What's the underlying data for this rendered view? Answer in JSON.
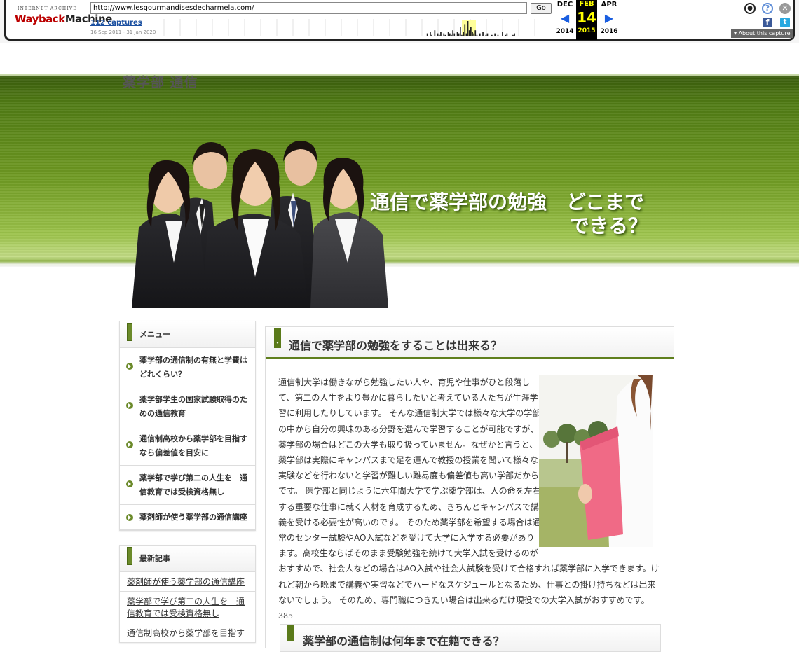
{
  "wayback": {
    "logo_top": "INTERNET ARCHIVE",
    "logo_main_a": "Wayback",
    "logo_main_b": "Machine",
    "url": "http://www.lesgourmandisesdecharmela.com/",
    "go_label": "Go",
    "captures": "112 captures",
    "range": "16 Sep 2011 - 31 Jan 2020",
    "prev_month": "DEC",
    "prev_year": "2014",
    "cur_month": "FEB",
    "cur_day": "14",
    "cur_year": "2015",
    "next_month": "APR",
    "next_year": "2016",
    "about": "About this capture",
    "sparkline": [
      0,
      0,
      0,
      0,
      0,
      0,
      0,
      0,
      0,
      0,
      0,
      0,
      0,
      0,
      0,
      0,
      0,
      0,
      0,
      0,
      0,
      0,
      0,
      0,
      0,
      0,
      0,
      0,
      0,
      0,
      0,
      0,
      0,
      0,
      0,
      0,
      0,
      0,
      0,
      0,
      0,
      0,
      0,
      0,
      0,
      0,
      0,
      0,
      0,
      0,
      0,
      0,
      0,
      0,
      0,
      0,
      0,
      0,
      0,
      0,
      0,
      0,
      0,
      0,
      0,
      0,
      0,
      0,
      0,
      0,
      0,
      0,
      0,
      0,
      0,
      0,
      0,
      0,
      0,
      0,
      0,
      0,
      0,
      0,
      0,
      0,
      0,
      0,
      0,
      0,
      0,
      0,
      0,
      0,
      0,
      0,
      0,
      0,
      0,
      0,
      0,
      0,
      0,
      0,
      0,
      0,
      0,
      0,
      0,
      0,
      0,
      0,
      0,
      0,
      0,
      0,
      0,
      0,
      0,
      0,
      0,
      0,
      0,
      0,
      0,
      0,
      0,
      0,
      0,
      0,
      0,
      0,
      0,
      0,
      0,
      0,
      0,
      0,
      0,
      0,
      0,
      0,
      0,
      0,
      0,
      0,
      0,
      0,
      0,
      0,
      0,
      0,
      0,
      0,
      0,
      0,
      0,
      0,
      0,
      0,
      0,
      0,
      0,
      0,
      0,
      0,
      0,
      0,
      0,
      0,
      0,
      0,
      0,
      0,
      0,
      0,
      0,
      2,
      0,
      3,
      1,
      0,
      4,
      0,
      2,
      1,
      3,
      0,
      2,
      1,
      0,
      3,
      2,
      1,
      4,
      2,
      0,
      3,
      2,
      6,
      1,
      3,
      8,
      2,
      10,
      4,
      6,
      3,
      2,
      4,
      1,
      0,
      2,
      0,
      3,
      0,
      1,
      2,
      0,
      0,
      1,
      0,
      2,
      0,
      1,
      0,
      0,
      3,
      0,
      1,
      2,
      0,
      0,
      0,
      1,
      2,
      0,
      0,
      0,
      0,
      0,
      0,
      0,
      0,
      0,
      0,
      0,
      0,
      0,
      0,
      0,
      0,
      0,
      0
    ]
  },
  "icons": {
    "user": "user-icon",
    "help": "help-icon",
    "close": "close-icon",
    "facebook": "facebook-icon",
    "twitter": "twitter-icon",
    "user_glyph": "●",
    "help_glyph": "?",
    "close_glyph": "✕",
    "fb_glyph": "f",
    "tw_glyph": "t"
  },
  "site": {
    "title": "薬学部 通信",
    "headline_line1": "通信で薬学部の勉強　どこまで",
    "headline_line2": "できる？"
  },
  "sidebar": {
    "menu_title": "メニュー",
    "menu_items": [
      "薬学部の通信制の有無と学費はどれくらい？",
      "薬学部学生の国家試験取得のための通信教育",
      "通信制高校から薬学部を目指すなら偏差値を目安に",
      "薬学部で学び第二の人生を　通信教育では受検資格無し",
      "薬剤師が使う薬学部の通信講座"
    ],
    "recent_title": "最新記事",
    "recent_items": [
      "薬剤師が使う薬学部の通信講座",
      "薬学部で学び第二の人生を　通信教育では受検資格無し",
      "通信制高校から薬学部を目指す"
    ]
  },
  "article": {
    "title": "通信で薬学部の勉強をすることは出来る？",
    "body": "通信制大学は働きながら勉強したい人や、育児や仕事がひと段落して、第二の人生をより豊かに暮らしたいと考えている人たちが生涯学習に利用したりしています。 そんな通信制大学では様々な大学の学部の中から自分の興味のある分野を選んで学習することが可能ですが、薬学部の場合はどこの大学も取り扱っていません。なぜかと言うと、薬学部は実際にキャンパスまで足を運んで教授の授業を聞いて様々な実験などを行わないと学習が難しい難易度も偏差値も高い学部だからです。 医学部と同じように六年間大学で学ぶ薬学部は、人の命を左右する重要な仕事に就く人材を育成するため、きちんとキャンパスで講義を受ける必要性が高いのです。 そのため薬学部を希望する場合は通常のセンター試験やAO入試などを受けて大学に入学する必要があります。高校生ならばそのまま受験勉強を続けて大学入試を受けるのがおすすめで、社会人などの場合はAO入試や社会人試験を受けて合格すれば薬学部に入学できます。けれど朝から晩まで講義や実習などでハードなスケジュールとなるため、仕事との掛け持ちなどは出来ないでしょう。 そのため、専門職につきたい場合は出来るだけ現役での大学入試がおすすめです。",
    "count": "385",
    "next_title": "薬学部の通信制は何年まで在籍できる？"
  }
}
